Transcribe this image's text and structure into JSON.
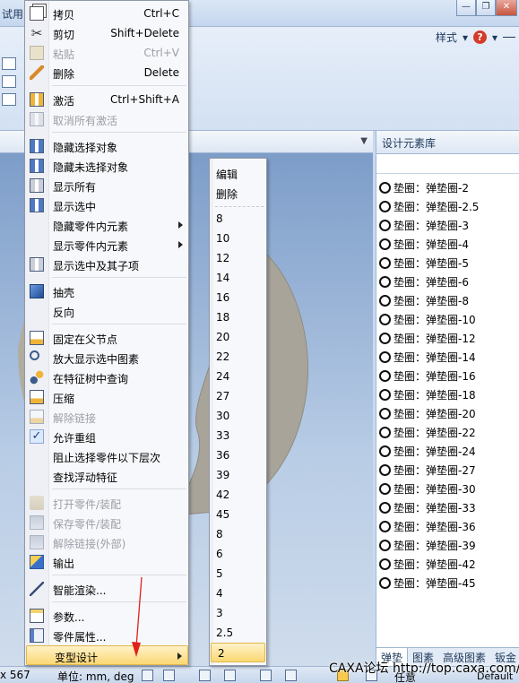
{
  "app": {
    "title_fragment": "试用",
    "ribbon_style_label": "样式",
    "help_glyph": "?",
    "window_buttons": {
      "minimize": "—",
      "restore": "❐",
      "close": "✕"
    }
  },
  "library_panel": {
    "title": "设计元素库",
    "items": [
      "垫圈：弹垫圈-2",
      "垫圈：弹垫圈-2.5",
      "垫圈：弹垫圈-3",
      "垫圈：弹垫圈-4",
      "垫圈：弹垫圈-5",
      "垫圈：弹垫圈-6",
      "垫圈：弹垫圈-8",
      "垫圈：弹垫圈-10",
      "垫圈：弹垫圈-12",
      "垫圈：弹垫圈-14",
      "垫圈：弹垫圈-16",
      "垫圈：弹垫圈-18",
      "垫圈：弹垫圈-20",
      "垫圈：弹垫圈-22",
      "垫圈：弹垫圈-24",
      "垫圈：弹垫圈-27",
      "垫圈：弹垫圈-30",
      "垫圈：弹垫圈-33",
      "垫圈：弹垫圈-36",
      "垫圈：弹垫圈-39",
      "垫圈：弹垫圈-42",
      "垫圈：弹垫圈-45"
    ],
    "tabs": [
      "弹垫",
      "图素",
      "高级图素",
      "钣金"
    ]
  },
  "context_menu": {
    "items": [
      {
        "label": "拷贝",
        "shortcut": "Ctrl+C",
        "icon": "copy-icon"
      },
      {
        "label": "剪切",
        "shortcut": "Shift+Delete",
        "icon": "cut-icon"
      },
      {
        "label": "粘贴",
        "shortcut": "Ctrl+V",
        "icon": "paste-icon",
        "disabled": true
      },
      {
        "label": "删除",
        "shortcut": "Delete",
        "icon": "delete-icon"
      },
      {
        "label": "激活",
        "shortcut": "Ctrl+Shift+A",
        "icon": "activate-icon"
      },
      {
        "label": "取消所有激活",
        "shortcut": "",
        "icon": "deactivate-all-icon",
        "disabled": true
      },
      {
        "label": "隐藏选择对象",
        "shortcut": "",
        "icon": "hide-selected-icon"
      },
      {
        "label": "隐藏未选择对象",
        "shortcut": "",
        "icon": "hide-unselected-icon"
      },
      {
        "label": "显示所有",
        "shortcut": "",
        "icon": "show-all-icon"
      },
      {
        "label": "显示选中",
        "shortcut": "",
        "icon": "show-selected-icon"
      },
      {
        "label": "隐藏零件内元素",
        "shortcut": "",
        "submenu": true
      },
      {
        "label": "显示零件内元素",
        "shortcut": "",
        "submenu": true
      },
      {
        "label": "显示选中及其子项",
        "shortcut": "",
        "icon": "show-selected-children-icon"
      },
      {
        "label": "抽壳",
        "shortcut": "",
        "icon": "shell-icon"
      },
      {
        "label": "反向",
        "shortcut": ""
      },
      {
        "label": "固定在父节点",
        "shortcut": "",
        "icon": "fix-to-parent-icon"
      },
      {
        "label": "放大显示选中图素",
        "shortcut": "",
        "icon": "zoom-selected-icon"
      },
      {
        "label": "在特征树中查询",
        "shortcut": "",
        "icon": "feature-tree-query-icon"
      },
      {
        "label": "压缩",
        "shortcut": "",
        "icon": "compress-icon"
      },
      {
        "label": "解除链接",
        "shortcut": "",
        "icon": "unlink-icon",
        "disabled": true
      },
      {
        "label": "允许重组",
        "shortcut": "",
        "icon": "check-icon"
      },
      {
        "label": "阻止选择零件以下层次",
        "shortcut": ""
      },
      {
        "label": "查找浮动特征",
        "shortcut": ""
      },
      {
        "label": "打开零件/装配",
        "shortcut": "",
        "icon": "open-part-icon",
        "disabled": true
      },
      {
        "label": "保存零件/装配",
        "shortcut": "",
        "icon": "save-part-icon",
        "disabled": true
      },
      {
        "label": "解除链接(外部)",
        "shortcut": "",
        "icon": "unlink-external-icon",
        "disabled": true
      },
      {
        "label": "输出",
        "shortcut": "",
        "icon": "export-icon"
      },
      {
        "label": "智能渲染...",
        "shortcut": "",
        "icon": "smart-render-icon"
      },
      {
        "label": "参数...",
        "shortcut": "",
        "icon": "parameters-icon"
      },
      {
        "label": "零件属性...",
        "shortcut": "",
        "icon": "part-properties-icon"
      },
      {
        "label": "变型设计",
        "shortcut": "",
        "submenu": true,
        "active": true
      }
    ]
  },
  "variant_submenu": {
    "items": [
      "编辑",
      "删除",
      "8",
      "10",
      "12",
      "14",
      "16",
      "18",
      "20",
      "22",
      "24",
      "27",
      "30",
      "33",
      "36",
      "39",
      "42",
      "45",
      "8",
      "6",
      "5",
      "4",
      "3",
      "2.5",
      "2"
    ],
    "active_index": 24
  },
  "statusbar": {
    "coord": "x 567",
    "units": "单位: mm, deg",
    "mode": "任意",
    "scheme": "Default"
  },
  "watermark": "CAXA论坛 http://top.caxa.com/",
  "colors": {
    "highlight": "#fbd874",
    "menu_bg": "#f7f8fb",
    "annotation_arrow": "#e0201a"
  }
}
